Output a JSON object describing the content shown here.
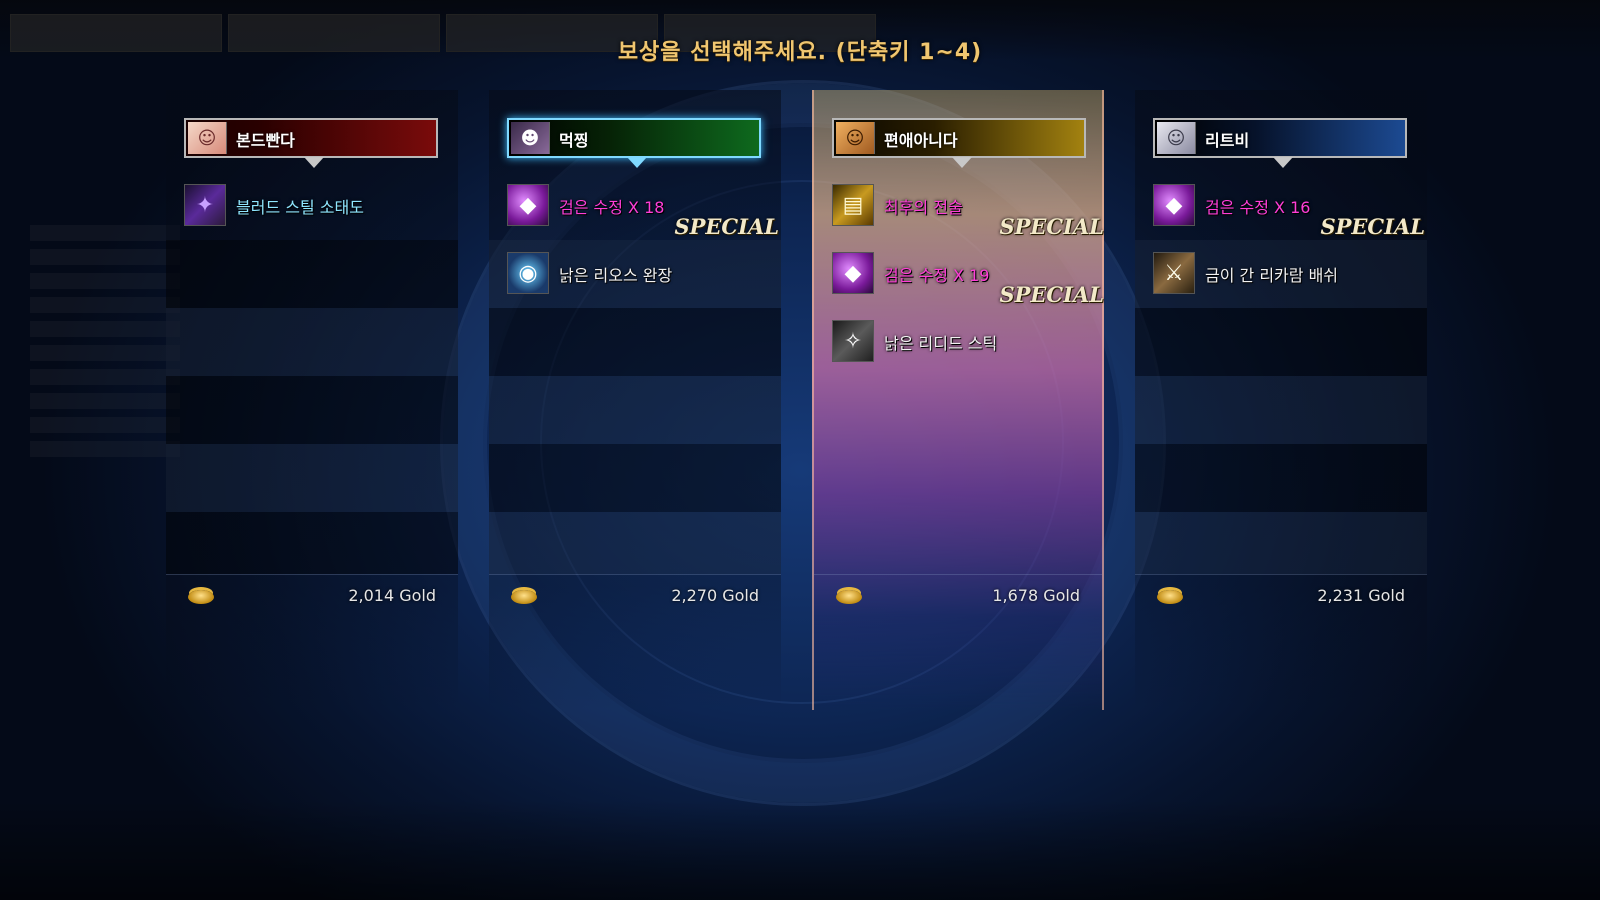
{
  "title": "보상을 선택해주세요. (단축키 1~4)",
  "panels": [
    {
      "player": "본드빤다",
      "items": [
        {
          "name": "블러드 스틸 소태도",
          "icon": "stick-icon",
          "special": false
        }
      ],
      "gold": "2,014 Gold"
    },
    {
      "player": "먹찡",
      "items": [
        {
          "name": "검은 수정 X 18",
          "icon": "crystal-icon",
          "special": true,
          "special_label": "SPECIAL"
        },
        {
          "name": "낡은 리오스 완장",
          "icon": "cloak-icon",
          "special": false
        }
      ],
      "gold": "2,270 Gold"
    },
    {
      "player": "편애아니다",
      "items": [
        {
          "name": "최후의 전술",
          "icon": "book-icon",
          "special": true,
          "special_label": "SPECIAL"
        },
        {
          "name": "검은 수정 X 19",
          "icon": "crystal-icon",
          "special": true,
          "special_label": "SPECIAL"
        },
        {
          "name": "낡은 리디드 스틱",
          "icon": "rapier-icon",
          "special": false
        }
      ],
      "gold": "1,678 Gold"
    },
    {
      "player": "리트비",
      "items": [
        {
          "name": "검은 수정 X 16",
          "icon": "crystal-icon",
          "special": true,
          "special_label": "SPECIAL"
        },
        {
          "name": "금이 간 리카람 배쉬",
          "icon": "dagger-icon",
          "special": false
        }
      ],
      "gold": "2,231 Gold"
    }
  ],
  "colors": {
    "title": "#f0c670",
    "rare_item": "#ff3ed8",
    "unique_item": "#8fe6ff",
    "normal_item": "#f2f2f2",
    "selected_border": "#7fd9ff"
  }
}
